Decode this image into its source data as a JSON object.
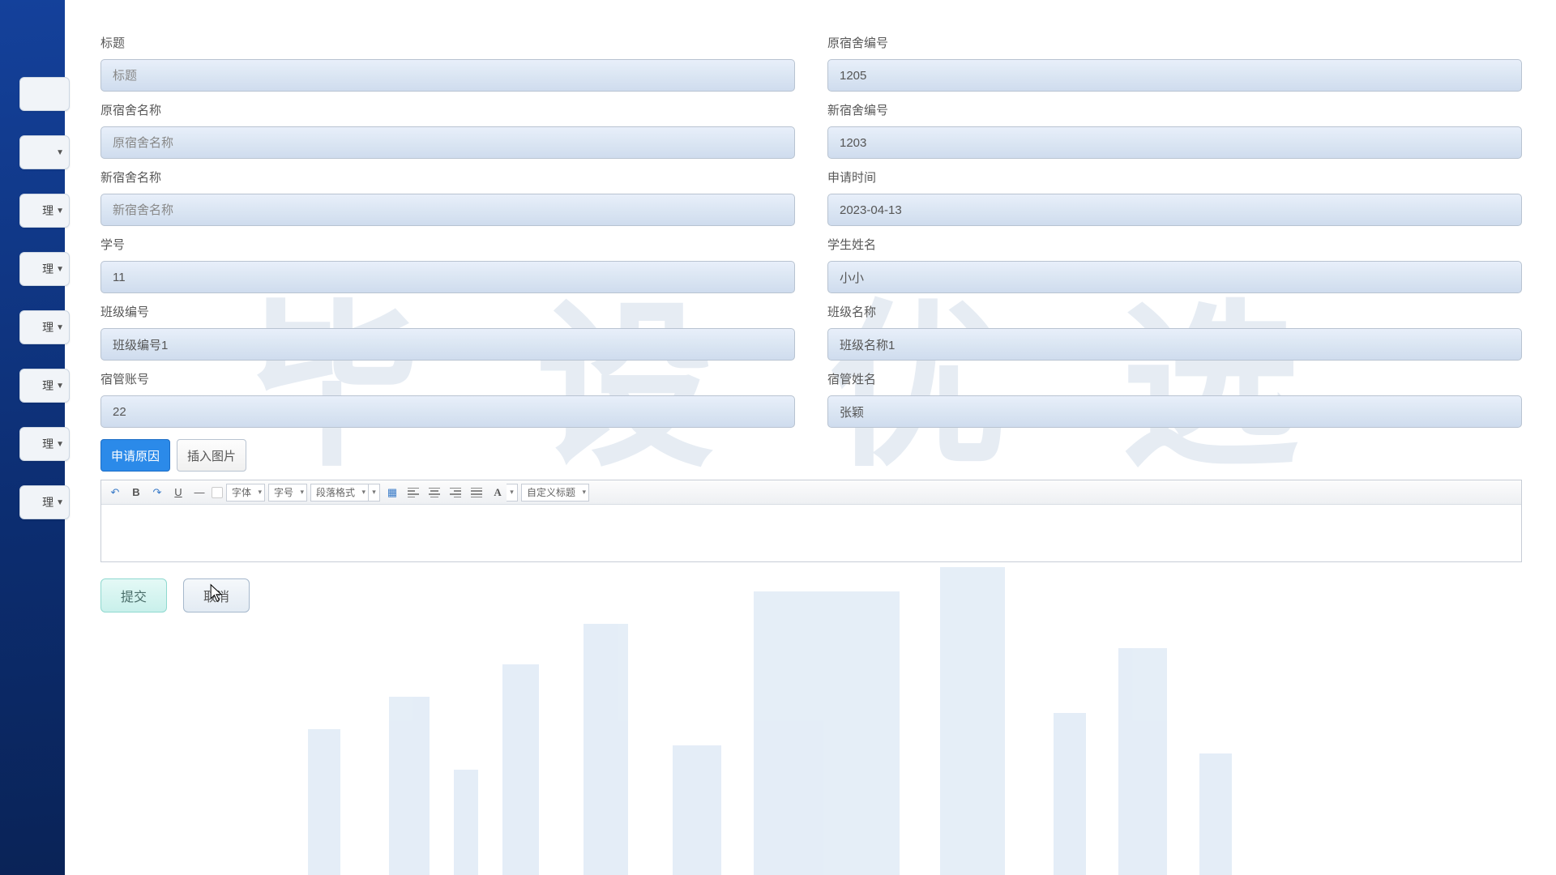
{
  "sidebar": {
    "items": [
      {
        "label": ""
      },
      {
        "label": ""
      },
      {
        "label": "理"
      },
      {
        "label": "理"
      },
      {
        "label": "理"
      },
      {
        "label": "理"
      },
      {
        "label": "理"
      },
      {
        "label": "理"
      }
    ]
  },
  "form": {
    "left": [
      {
        "label": "标题",
        "placeholder": "标题",
        "value": ""
      },
      {
        "label": "原宿舍名称",
        "placeholder": "原宿舍名称",
        "value": ""
      },
      {
        "label": "新宿舍名称",
        "placeholder": "新宿舍名称",
        "value": ""
      },
      {
        "label": "学号",
        "placeholder": "",
        "value": "11"
      },
      {
        "label": "班级编号",
        "placeholder": "",
        "value": "班级编号1"
      },
      {
        "label": "宿管账号",
        "placeholder": "",
        "value": "22"
      }
    ],
    "right": [
      {
        "label": "原宿舍编号",
        "placeholder": "",
        "value": "1205"
      },
      {
        "label": "新宿舍编号",
        "placeholder": "",
        "value": "1203"
      },
      {
        "label": "申请时间",
        "placeholder": "",
        "value": "2023-04-13"
      },
      {
        "label": "学生姓名",
        "placeholder": "",
        "value": "小小"
      },
      {
        "label": "班级名称",
        "placeholder": "",
        "value": "班级名称1"
      },
      {
        "label": "宿管姓名",
        "placeholder": "",
        "value": "张颖"
      }
    ]
  },
  "tabs": [
    {
      "label": "申请原因",
      "active": true
    },
    {
      "label": "插入图片",
      "active": false
    }
  ],
  "editor": {
    "font_family": "字体",
    "font_size": "字号",
    "paragraph_format": "段落格式",
    "custom_title": "自定义标题"
  },
  "actions": {
    "submit": "提交",
    "cancel": "取消"
  }
}
